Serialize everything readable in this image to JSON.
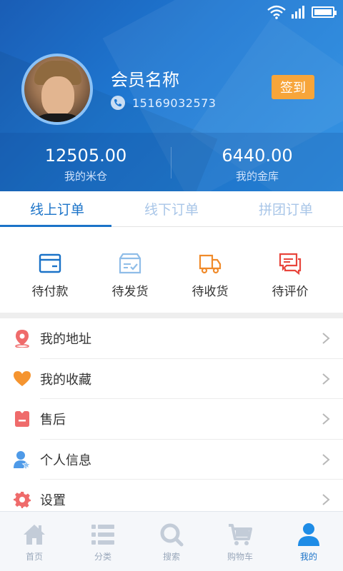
{
  "profile": {
    "member_name": "会员名称",
    "phone": "15169032573",
    "checkin_label": "签到"
  },
  "stats": [
    {
      "value": "12505.00",
      "label": "我的米仓"
    },
    {
      "value": "6440.00",
      "label": "我的金库"
    }
  ],
  "tabs": [
    {
      "label": "线上订单",
      "active": true
    },
    {
      "label": "线下订单",
      "active": false
    },
    {
      "label": "拼团订单",
      "active": false
    }
  ],
  "order_status": [
    {
      "label": "待付款",
      "icon": "wallet-icon",
      "color": "#1b73c8"
    },
    {
      "label": "待发货",
      "icon": "package-icon",
      "color": "#8fbde8"
    },
    {
      "label": "待收货",
      "icon": "truck-icon",
      "color": "#f08a2a"
    },
    {
      "label": "待评价",
      "icon": "comment-icon",
      "color": "#e8453c"
    }
  ],
  "menu": [
    {
      "label": "我的地址",
      "icon": "location-icon",
      "color": "#ef6b6b"
    },
    {
      "label": "我的收藏",
      "icon": "heart-icon",
      "color": "#f5942f"
    },
    {
      "label": "售后",
      "icon": "aftersale-icon",
      "color": "#ef6b6b"
    },
    {
      "label": "个人信息",
      "icon": "user-info-icon",
      "color": "#4e9ae8"
    },
    {
      "label": "设置",
      "icon": "gear-icon",
      "color": "#ef6b6b"
    }
  ],
  "bottom_nav": [
    {
      "label": "首页",
      "icon": "home-icon",
      "active": false
    },
    {
      "label": "分类",
      "icon": "category-icon",
      "active": false
    },
    {
      "label": "搜索",
      "icon": "search-icon",
      "active": false
    },
    {
      "label": "购物车",
      "icon": "cart-icon",
      "active": false
    },
    {
      "label": "我的",
      "icon": "profile-icon",
      "active": true
    }
  ],
  "colors": {
    "header_blue": "#1f79d3",
    "accent": "#1b73c8",
    "checkin": "#f7a53a",
    "nav_inactive": "#9aa8bb"
  }
}
